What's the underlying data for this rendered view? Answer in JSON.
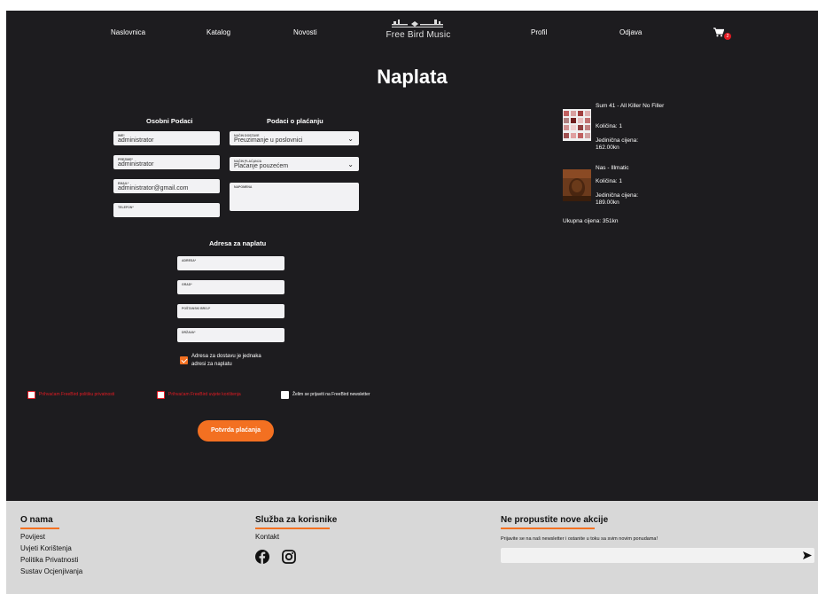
{
  "nav": {
    "items": [
      "Naslovnica",
      "Katalog",
      "Novosti",
      "Profil",
      "Odjava"
    ],
    "logo_text": "Free Bird Music",
    "cart_count": "2"
  },
  "page_title": "Naplata",
  "personal": {
    "title": "Osobni Podaci",
    "fields": [
      {
        "label": "IME*",
        "value": "administrator"
      },
      {
        "label": "PREZIME*",
        "value": "administrator"
      },
      {
        "label": "EMAIL*",
        "value": "administrator@gmail.com"
      },
      {
        "label": "TELEFON*",
        "value": ""
      }
    ]
  },
  "payment": {
    "title": "Podaci o plaćanju",
    "delivery": {
      "label": "NAČIN DOSTAVE",
      "value": "Preuzimanje u poslovnici"
    },
    "method": {
      "label": "NAČIN PLAĆANJA",
      "value": "Plaćanje pouzećem"
    },
    "note": {
      "label": "NAPOMENA",
      "value": ""
    }
  },
  "billing": {
    "title": "Adresa za naplatu",
    "fields": [
      {
        "label": "ADRESA*",
        "value": ""
      },
      {
        "label": "GRAD*",
        "value": ""
      },
      {
        "label": "POŠTANSKI BROJ*",
        "value": ""
      },
      {
        "label": "DRŽAVA*",
        "value": ""
      }
    ],
    "same_address_label": "Adresa za dostavu je jednaka adresi za naplatu",
    "same_address_checked": true
  },
  "consents": [
    {
      "label": "Prihvaćam FreeBird politiku privatnosti",
      "checked": false,
      "required": true
    },
    {
      "label": "Prihvaćam FreeBird uvjete korištenja",
      "checked": false,
      "required": true
    },
    {
      "label": "Želim se prijaviti na FreeBird newsletter",
      "checked": false,
      "required": false
    }
  ],
  "submit_label": "Potvrda plaćanja",
  "summary": {
    "items": [
      {
        "title": "Sum 41 - All Killer No Filler",
        "quantity": "Količina: 1",
        "unit_price": "Jedinična cijena: 162.00kn"
      },
      {
        "title": "Nas - Illmatic",
        "quantity": "Količina: 1",
        "unit_price": "Jedinična cijena: 189.00kn"
      }
    ],
    "total": "Ukupna cijena: 351kn"
  },
  "footer": {
    "about": {
      "title": "O nama",
      "links": [
        "Povijest",
        "Uvjeti Korištenja",
        "Politika Privatnosti",
        "Sustav Ocjenjivanja"
      ]
    },
    "service": {
      "title": "Služba za korisnike",
      "links": [
        "Kontakt"
      ]
    },
    "newsletter": {
      "title": "Ne propustite nove akcije",
      "text": "Prijavite se na naš newsletter i ostanite u toku sa svim novim ponudama!",
      "input_value": ""
    }
  },
  "colors": {
    "background": "#1d1c1f",
    "accent": "#f37021",
    "required": "#e31b23",
    "footer": "#d8d8d8"
  }
}
